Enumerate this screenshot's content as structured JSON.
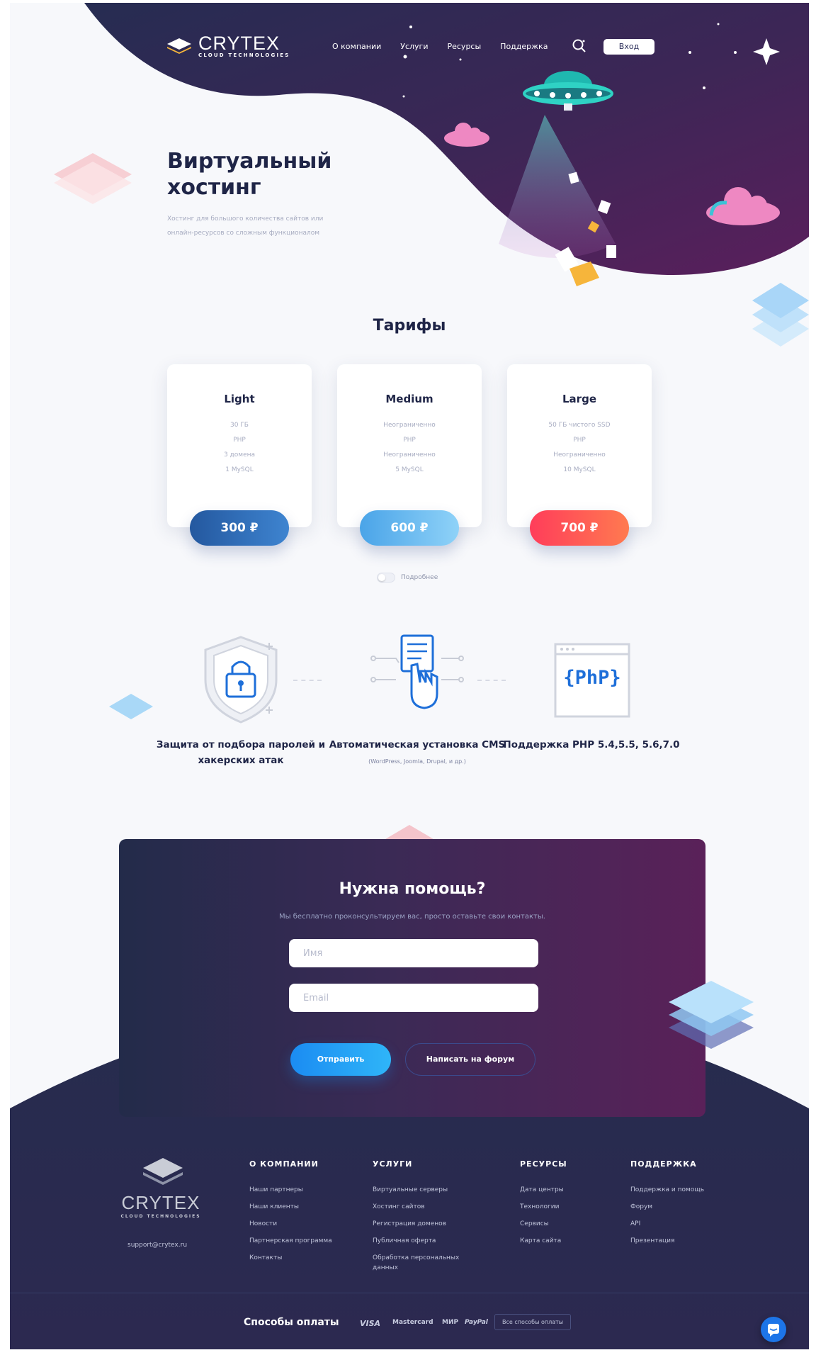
{
  "header": {
    "brand": "CRYTEX",
    "brand_sub": "CLOUD TECHNOLOGIES",
    "nav": [
      "О компании",
      "Услуги",
      "Ресурсы",
      "Поддержка"
    ],
    "login_label": "Вход"
  },
  "hero": {
    "title": "Виртуальный хостинг",
    "subtitle": "Хостинг для большого количества сайтов или онлайн-ресурсов со сложным функционалом"
  },
  "tariffs": {
    "title": "Тарифы",
    "plans": [
      {
        "name": "Light",
        "features": [
          "30 ГБ",
          "PHP",
          "3 домена",
          "1 MySQL"
        ],
        "price": "300 ₽",
        "color": "#2f6db8"
      },
      {
        "name": "Medium",
        "features": [
          "Неограниченно",
          "PHP",
          "Неограниченно",
          "5 MySQL"
        ],
        "price": "600 ₽",
        "color": "#5db7f0"
      },
      {
        "name": "Large",
        "features": [
          "50 ГБ чистого SSD",
          "PHP",
          "Неограниченно",
          "10 MySQL"
        ],
        "price": "700 ₽",
        "color": "#ff4a5d"
      }
    ],
    "more_label": "Подробнее"
  },
  "features": [
    {
      "title": "Защита от подбора паролей и хакерских атак",
      "note": ""
    },
    {
      "title": "Автоматическая установка CMS",
      "note": "(WordPress, Joomla, Drupal, и др.)"
    },
    {
      "title": "Поддержка PHP 5.4,5.5, 5.6,7.0",
      "note": ""
    }
  ],
  "php_icon_text": "{PhP}",
  "help": {
    "title": "Нужна помощь?",
    "subtitle": "Мы бесплатно проконсультируем вас, просто оставьте свои контакты.",
    "name_placeholder": "Имя",
    "email_placeholder": "Email",
    "send_label": "Отправить",
    "forum_label": "Написать на форум"
  },
  "footer": {
    "email": "support@crytex.ru",
    "columns": [
      {
        "title": "О КОМПАНИИ",
        "links": [
          "Наши партнеры",
          "Наши клиенты",
          "Новости",
          "Партнерская программа",
          "Контакты"
        ]
      },
      {
        "title": "УСЛУГИ",
        "links": [
          "Виртуальные серверы",
          "Хостинг сайтов",
          "Регистрация доменов",
          "Публичная оферта",
          "Обработка персональных данных"
        ]
      },
      {
        "title": "РЕСУРСЫ",
        "links": [
          "Дата центры",
          "Технологии",
          "Сервисы",
          "Карта сайта"
        ]
      },
      {
        "title": "ПОДДЕРЖКА",
        "links": [
          "Поддержка и помощь",
          "Форум",
          "API",
          "Презентация"
        ]
      }
    ],
    "payment_title": "Способы оплаты",
    "payment_methods": [
      "VISA",
      "Mastercard",
      "МИР",
      "PayPal"
    ],
    "payment_all": "Все способы оплаты"
  },
  "colors": {
    "hero_gradient_start": "#2a2f58",
    "hero_gradient_end": "#5a1f5c",
    "accent_blue": "#1b8cf2",
    "accent_red": "#ff4a5d",
    "text_dark": "#1f2547"
  }
}
